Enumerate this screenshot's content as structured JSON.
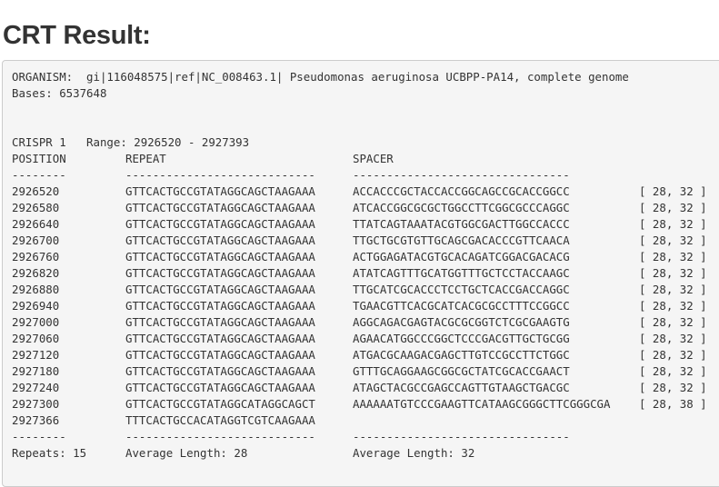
{
  "page_title": "CRT Result:",
  "organism_line": "ORGANISM:  gi|116048575|ref|NC_008463.1| Pseudomonas aeruginosa UCBPP-PA14, complete genome",
  "bases_line": "Bases: 6537648",
  "crispr_header": "CRISPR 1   Range: 2926520 - 2927393",
  "columns": {
    "position": "POSITION",
    "repeat": "REPEAT",
    "spacer": "SPACER"
  },
  "dividers": {
    "position": "--------",
    "repeat": "----------------------------",
    "spacer": "--------------------------------"
  },
  "rows": [
    {
      "position": "2926520",
      "repeat": "GTTCACTGCCGTATAGGCAGCTAAGAAA",
      "spacer": "ACCACCCGCTACCACCGGCAGCCGCACCGGCC",
      "lengths": "[ 28, 32 ]"
    },
    {
      "position": "2926580",
      "repeat": "GTTCACTGCCGTATAGGCAGCTAAGAAA",
      "spacer": "ATCACCGGCGCGCTGGCCTTCGGCGCCCAGGC",
      "lengths": "[ 28, 32 ]"
    },
    {
      "position": "2926640",
      "repeat": "GTTCACTGCCGTATAGGCAGCTAAGAAA",
      "spacer": "TTATCAGTAAATACGTGGCGACTTGGCCACCC",
      "lengths": "[ 28, 32 ]"
    },
    {
      "position": "2926700",
      "repeat": "GTTCACTGCCGTATAGGCAGCTAAGAAA",
      "spacer": "TTGCTGCGTGTTGCAGCGACACCCGTTCAACA",
      "lengths": "[ 28, 32 ]"
    },
    {
      "position": "2926760",
      "repeat": "GTTCACTGCCGTATAGGCAGCTAAGAAA",
      "spacer": "ACTGGAGATACGTGCACAGATCGGACGACACG",
      "lengths": "[ 28, 32 ]"
    },
    {
      "position": "2926820",
      "repeat": "GTTCACTGCCGTATAGGCAGCTAAGAAA",
      "spacer": "ATATCAGTTTGCATGGTTTGCTCCTACCAAGC",
      "lengths": "[ 28, 32 ]"
    },
    {
      "position": "2926880",
      "repeat": "GTTCACTGCCGTATAGGCAGCTAAGAAA",
      "spacer": "TTGCATCGCACCCTCCTGCTCACCGACCAGGC",
      "lengths": "[ 28, 32 ]"
    },
    {
      "position": "2926940",
      "repeat": "GTTCACTGCCGTATAGGCAGCTAAGAAA",
      "spacer": "TGAACGTTCACGCATCACGCGCCTTTCCGGCC",
      "lengths": "[ 28, 32 ]"
    },
    {
      "position": "2927000",
      "repeat": "GTTCACTGCCGTATAGGCAGCTAAGAAA",
      "spacer": "AGGCAGACGAGTACGCGCGGTCTCGCGAAGTG",
      "lengths": "[ 28, 32 ]"
    },
    {
      "position": "2927060",
      "repeat": "GTTCACTGCCGTATAGGCAGCTAAGAAA",
      "spacer": "AGAACATGGCCCGGCTCCCGACGTTGCTGCGG",
      "lengths": "[ 28, 32 ]"
    },
    {
      "position": "2927120",
      "repeat": "GTTCACTGCCGTATAGGCAGCTAAGAAA",
      "spacer": "ATGACGCAAGACGAGCTTGTCCGCCTTCTGGC",
      "lengths": "[ 28, 32 ]"
    },
    {
      "position": "2927180",
      "repeat": "GTTCACTGCCGTATAGGCAGCTAAGAAA",
      "spacer": "GTTTGCAGGAAGCGGCGCTATCGCACCGAACT",
      "lengths": "[ 28, 32 ]"
    },
    {
      "position": "2927240",
      "repeat": "GTTCACTGCCGTATAGGCAGCTAAGAAA",
      "spacer": "ATAGCTACGCCGAGCCAGTTGTAAGCTGACGC",
      "lengths": "[ 28, 32 ]"
    },
    {
      "position": "2927300",
      "repeat": "GTTCACTGCCGTATAGGCATAGGCAGCT",
      "spacer": "AAAAAATGTCCCGAAGTTCATAAGCGGGCTTCGGGCGA",
      "lengths": "[ 28, 38 ]"
    },
    {
      "position": "2927366",
      "repeat": "TTTCACTGCCACATAGGTCGTCAAGAAA",
      "spacer": "",
      "lengths": ""
    }
  ],
  "footer": {
    "repeats": "Repeats: 15",
    "repeat_avg": "Average Length: 28",
    "spacer_avg": "Average Length: 32"
  }
}
